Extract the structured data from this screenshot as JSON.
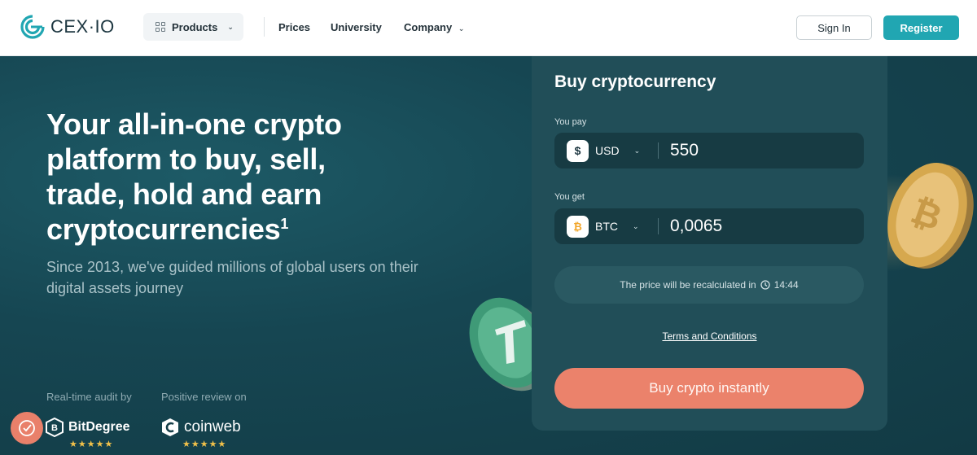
{
  "header": {
    "logo_text": "CEX·IO",
    "nav": {
      "products": "Products",
      "prices": "Prices",
      "university": "University",
      "company": "Company"
    },
    "sign_in": "Sign In",
    "register": "Register",
    "accent_color": "#21a6b2"
  },
  "hero": {
    "title": "Your all-in-one crypto platform to buy, sell, trade, hold and earn cryptocurrencies",
    "title_footnote": "1",
    "subtitle": "Since 2013, we've guided millions of global users on their digital assets journey",
    "trust": [
      {
        "label": "Real-time audit by",
        "brand": "BitDegree",
        "stars": "★★★★★"
      },
      {
        "label": "Positive review on",
        "brand": "coinweb",
        "stars": "★★★★★"
      }
    ]
  },
  "buy_card": {
    "title": "Buy cryptocurrency",
    "pay": {
      "label": "You pay",
      "currency": "USD",
      "currency_symbol": "$",
      "amount": "550"
    },
    "get": {
      "label": "You get",
      "currency": "BTC",
      "currency_symbol": "₿",
      "amount": "0,0065"
    },
    "timer_text": "The price will be recalculated in",
    "timer_value": "14:44",
    "terms": "Terms and Conditions",
    "buy_button": "Buy crypto instantly",
    "button_color": "#eb826b"
  },
  "icons": [
    "cex-logo-icon",
    "grid-icon",
    "chevron-down-icon",
    "dollar-icon",
    "bitcoin-icon",
    "clock-icon",
    "chat-icon",
    "bitdegree-logo-icon",
    "coinweb-logo-icon",
    "tether-coin-icon",
    "bitcoin-coin-icon"
  ]
}
